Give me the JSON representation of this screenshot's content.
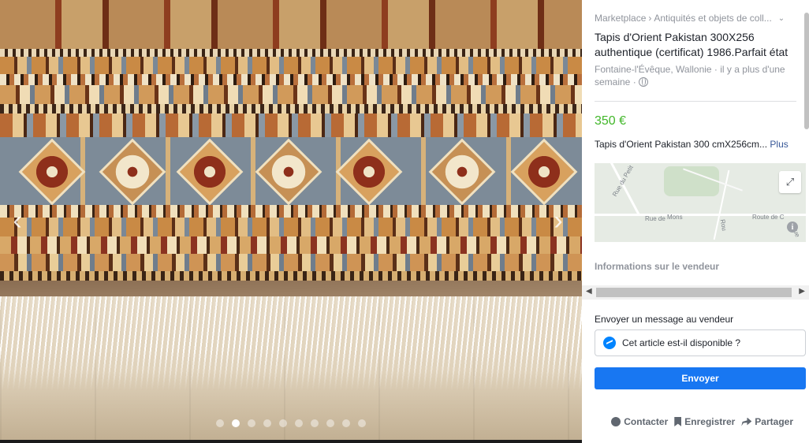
{
  "viewer": {
    "prev_arrow": "‹",
    "next_arrow": "›",
    "photo_count": 10,
    "active_photo_index": 1
  },
  "listing": {
    "breadcrumb": [
      "Marketplace",
      "Antiquités et objets de coll..."
    ],
    "breadcrumb_separator": "›",
    "breadcrumb_toggle": "⌄",
    "title": "Tapis d'Orient Pakistan 300X256 authentique (certificat) 1986.Parfait état",
    "location": "Fontaine-l'Évêque, Wallonie · il y a plus d'une semaine ·",
    "price": "350 €",
    "description": "Tapis d'Orient Pakistan 300 cmX256cm...",
    "more_label": "Plus",
    "map": {
      "labels": [
        "Rue du Petit",
        "Rue de",
        "Mons",
        "Rou",
        "Route de C",
        "Rue"
      ],
      "expand_icon": "⤢",
      "info_icon": "i"
    },
    "seller_heading": "Informations sur le vendeur"
  },
  "message": {
    "label": "Envoyer un message au vendeur",
    "input_value": "Cet article est-il disponible ?",
    "send_label": "Envoyer"
  },
  "actions": {
    "contact": "Contacter",
    "save": "Enregistrer",
    "share": "Partager"
  },
  "colors": {
    "price": "#42b72a",
    "button": "#1877f2",
    "link": "#385898",
    "muted": "#90949c"
  }
}
